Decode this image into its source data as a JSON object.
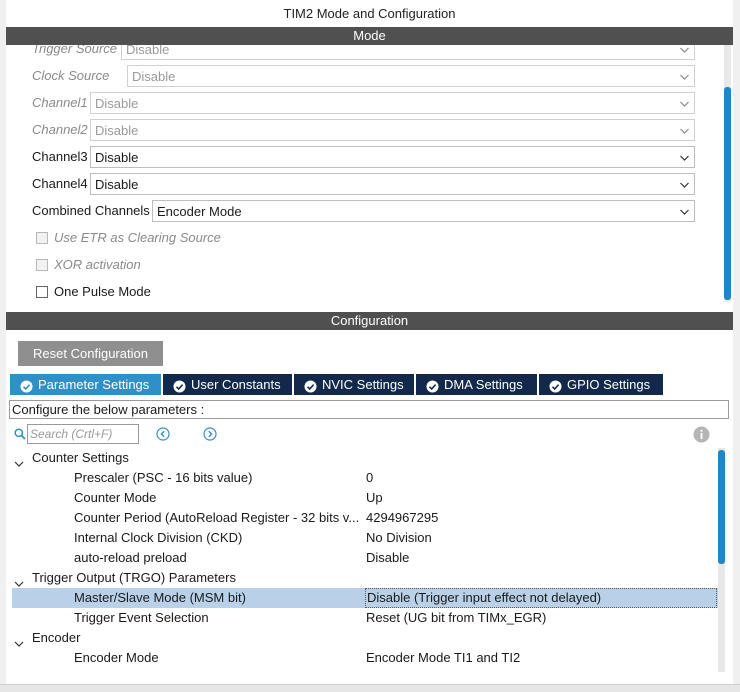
{
  "window": {
    "title": "TIM2 Mode and Configuration"
  },
  "mode_section": {
    "header": "Mode",
    "rows": [
      {
        "label": "Trigger Source",
        "value": "Disable",
        "enabled": false
      },
      {
        "label": "Clock Source",
        "value": "Disable",
        "enabled": false
      },
      {
        "label": "Channel1",
        "value": "Disable",
        "enabled": false
      },
      {
        "label": "Channel2",
        "value": "Disable",
        "enabled": false
      },
      {
        "label": "Channel3",
        "value": "Disable",
        "enabled": true
      },
      {
        "label": "Channel4",
        "value": "Disable",
        "enabled": true
      },
      {
        "label": "Combined Channels",
        "value": "Encoder Mode",
        "enabled": true
      }
    ],
    "checkboxes": [
      {
        "label": "Use ETR as Clearing Source",
        "enabled": false,
        "checked": false
      },
      {
        "label": "XOR activation",
        "enabled": false,
        "checked": false
      },
      {
        "label": "One Pulse Mode",
        "enabled": true,
        "checked": false
      }
    ]
  },
  "config_section": {
    "header": "Configuration",
    "reset_label": "Reset Configuration",
    "tabs": [
      {
        "label": "Parameter Settings",
        "active": true
      },
      {
        "label": "User Constants",
        "active": false
      },
      {
        "label": "NVIC Settings",
        "active": false
      },
      {
        "label": "DMA Settings",
        "active": false
      },
      {
        "label": "GPIO Settings",
        "active": false
      }
    ],
    "description": "Configure the below parameters :",
    "search_placeholder": "Search (Crtl+F)",
    "tree": {
      "groups": [
        {
          "name": "Counter Settings",
          "params": [
            {
              "name": "Prescaler (PSC - 16 bits value)",
              "value": "0"
            },
            {
              "name": "Counter Mode",
              "value": "Up"
            },
            {
              "name": "Counter Period (AutoReload Register - 32 bits v...",
              "value": "4294967295"
            },
            {
              "name": "Internal Clock Division (CKD)",
              "value": "No Division"
            },
            {
              "name": "auto-reload preload",
              "value": "Disable"
            }
          ]
        },
        {
          "name": "Trigger Output (TRGO) Parameters",
          "params": [
            {
              "name": "Master/Slave Mode (MSM bit)",
              "value": "Disable (Trigger input effect not delayed)",
              "selected": true
            },
            {
              "name": "Trigger Event Selection",
              "value": "Reset (UG bit from TIMx_EGR)"
            }
          ]
        },
        {
          "name": "Encoder",
          "params": [
            {
              "name": "Encoder Mode",
              "value": "Encoder Mode TI1 and TI2"
            }
          ]
        }
      ]
    }
  },
  "colors": {
    "section_bar": "#505050",
    "tab_dark": "#13294b",
    "tab_active": "#2f8fc6",
    "scroll_thumb": "#1f86c8",
    "selected_row": "#b8d1e8",
    "reset_button": "#8f8f8f"
  },
  "icons": {
    "tab": "check-circle-icon",
    "search": "magnifier-icon",
    "prev": "chevron-left-circle-icon",
    "next": "chevron-right-circle-icon",
    "info": "info-icon",
    "expand": "chevron-down-icon",
    "dropdown": "chevron-down-icon"
  }
}
